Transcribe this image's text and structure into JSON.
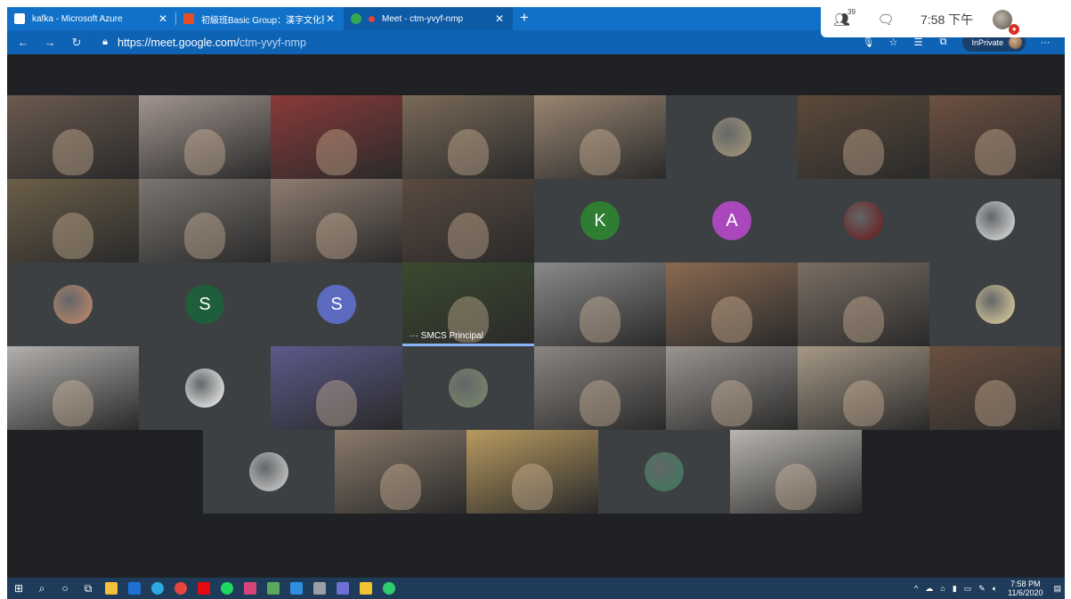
{
  "browser": {
    "tabs": [
      {
        "title": "kafka - Microsoft Azure",
        "active": false,
        "favicon_color": "#ffffff"
      },
      {
        "title": "初級班Basic Group：漢字文化影",
        "active": false,
        "favicon_color": "#e44d26"
      },
      {
        "title": "Meet - ctm-yvyf-nmp",
        "active": true,
        "favicon_color": "#34a853"
      }
    ],
    "new_tab": "+",
    "window_controls": [
      "—",
      "☐",
      "✕"
    ],
    "url_host": "https://meet.google.com/",
    "url_path": "ctm-yvyf-nmp",
    "inprivate_label": "InPrivate"
  },
  "meet": {
    "participant_count": "39",
    "time": "7:58 下午",
    "principal_name": "SMCS Principal",
    "tiles": [
      {
        "kind": "video",
        "label": "",
        "color": "#6b5a4f"
      },
      {
        "kind": "video",
        "label": "",
        "color": "#a2958f"
      },
      {
        "kind": "video",
        "label": "",
        "color": "#8a3a3a"
      },
      {
        "kind": "video",
        "label": "",
        "color": "#7a6a58"
      },
      {
        "kind": "video",
        "label": "",
        "color": "#9a8672"
      },
      {
        "kind": "image-avatar",
        "label": "",
        "color": "#a99c7a"
      },
      {
        "kind": "video",
        "label": "",
        "color": "#5c4a3a"
      },
      {
        "kind": "video",
        "label": "",
        "color": "#6d5141"
      },
      {
        "kind": "video",
        "label": "",
        "color": "#6b5e48"
      },
      {
        "kind": "video",
        "label": "",
        "color": "#7a7570"
      },
      {
        "kind": "video",
        "label": "",
        "color": "#8e7c70"
      },
      {
        "kind": "video",
        "label": "",
        "color": "#5a4a40"
      },
      {
        "kind": "letter",
        "letter": "K",
        "color": "#2e7d32"
      },
      {
        "kind": "letter",
        "letter": "A",
        "color": "#ab47bc"
      },
      {
        "kind": "image-avatar",
        "label": "",
        "color": "#6b1414"
      },
      {
        "kind": "image-avatar",
        "label": "",
        "color": "#e8e8e8"
      },
      {
        "kind": "image-avatar",
        "label": "",
        "color": "#c98a6a"
      },
      {
        "kind": "letter",
        "letter": "S",
        "color": "#1e5e3a"
      },
      {
        "kind": "letter",
        "letter": "S",
        "color": "#5c6bc0"
      },
      {
        "kind": "video-principal",
        "label": "SMCS Principal",
        "color": "#3b4a2f"
      },
      {
        "kind": "video",
        "label": "",
        "color": "#8a8a8a"
      },
      {
        "kind": "video",
        "label": "",
        "color": "#8a6a52"
      },
      {
        "kind": "video",
        "label": "",
        "color": "#7a6e64"
      },
      {
        "kind": "image-avatar",
        "label": "",
        "color": "#e8d8a0"
      },
      {
        "kind": "video",
        "label": "",
        "color": "#b3b0ad"
      },
      {
        "kind": "image-avatar",
        "label": "",
        "color": "#ffffff"
      },
      {
        "kind": "video",
        "label": "",
        "color": "#5b5a8a"
      },
      {
        "kind": "image-avatar",
        "label": "",
        "color": "#7a8a6a"
      },
      {
        "kind": "video",
        "label": "",
        "color": "#8a8580"
      },
      {
        "kind": "video",
        "label": "",
        "color": "#9a9590"
      },
      {
        "kind": "video",
        "label": "",
        "color": "#a69886"
      },
      {
        "kind": "video",
        "label": "",
        "color": "#6a5040"
      },
      {
        "kind": "image-avatar",
        "label": "",
        "color": "#d8d8d8"
      },
      {
        "kind": "video",
        "label": "",
        "color": "#8a7a6a"
      },
      {
        "kind": "video",
        "label": "",
        "color": "#b89a60"
      },
      {
        "kind": "image-avatar",
        "label": "",
        "color": "#3a7a5a"
      },
      {
        "kind": "video",
        "label": "",
        "color": "#b8b5b0"
      }
    ]
  },
  "taskbar": {
    "time": "7:58 PM",
    "date": "11/6/2020"
  }
}
